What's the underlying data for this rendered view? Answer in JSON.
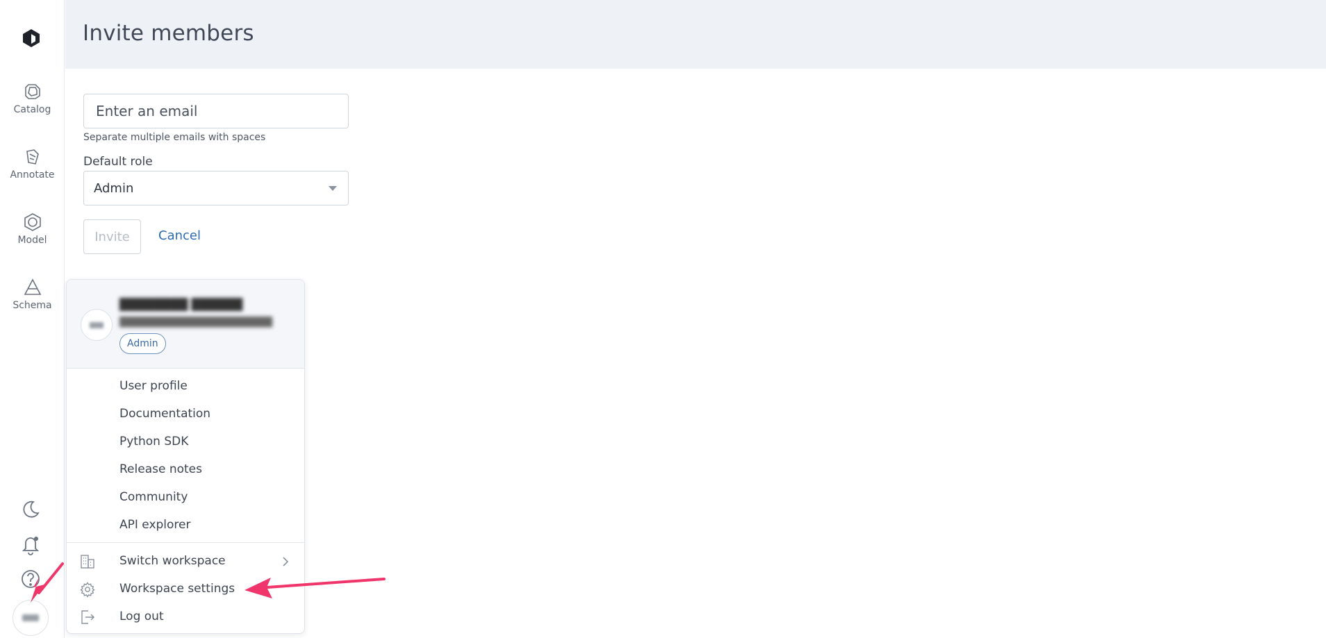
{
  "page": {
    "title": "Invite members"
  },
  "rail": {
    "nav": [
      {
        "label": "Catalog"
      },
      {
        "label": "Annotate"
      },
      {
        "label": "Model"
      },
      {
        "label": "Schema"
      }
    ]
  },
  "form": {
    "email_placeholder": "Enter an email",
    "helper": "Separate multiple emails with spaces",
    "role_label": "Default role",
    "role_value": "Admin",
    "invite_label": "Invite",
    "cancel_label": "Cancel"
  },
  "user_menu": {
    "role_badge": "Admin",
    "items": [
      {
        "label": "User profile"
      },
      {
        "label": "Documentation"
      },
      {
        "label": "Python SDK"
      },
      {
        "label": "Release notes"
      },
      {
        "label": "Community"
      },
      {
        "label": "API explorer"
      }
    ],
    "workspace_items": [
      {
        "label": "Switch workspace",
        "icon": "building-icon"
      },
      {
        "label": "Workspace settings",
        "icon": "gear-icon"
      },
      {
        "label": "Log out",
        "icon": "logout-icon"
      }
    ]
  },
  "colors": {
    "accent": "#2c6ab3",
    "header_bg": "#eef1f6",
    "annotation_arrow": "#f0356b"
  }
}
